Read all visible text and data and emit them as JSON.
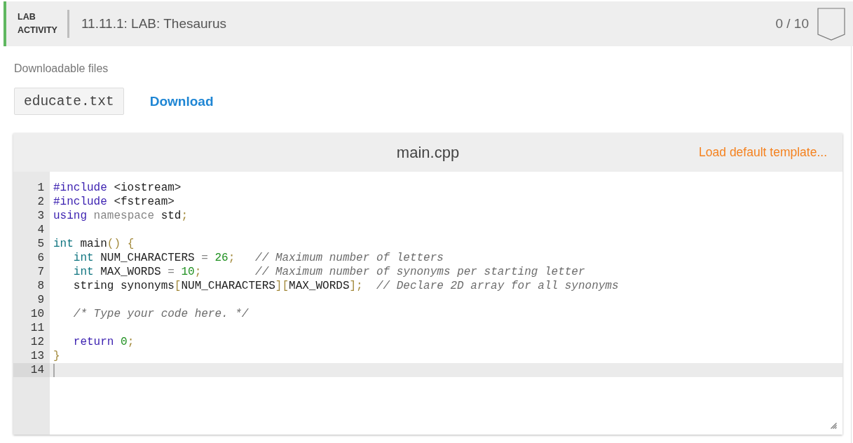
{
  "header": {
    "type_label": "LAB ACTIVITY",
    "title": "11.11.1: LAB: Thesaurus",
    "score": "0 / 10"
  },
  "downloads": {
    "label": "Downloadable files",
    "file": "educate.txt",
    "link": "Download"
  },
  "editor": {
    "filename": "main.cpp",
    "template_link": "Load default template...",
    "lines": [
      {
        "number": "1",
        "active": false,
        "tokens": [
          {
            "kind": "keyword",
            "text": "#include"
          },
          {
            "kind": "plain",
            "text": " <iostream>"
          }
        ]
      },
      {
        "number": "2",
        "active": false,
        "tokens": [
          {
            "kind": "keyword",
            "text": "#include"
          },
          {
            "kind": "plain",
            "text": " <fstream>"
          }
        ]
      },
      {
        "number": "3",
        "active": false,
        "tokens": [
          {
            "kind": "keyword",
            "text": "using"
          },
          {
            "kind": "muted",
            "text": " namespace"
          },
          {
            "kind": "plain",
            "text": " std"
          },
          {
            "kind": "punct",
            "text": ";"
          }
        ]
      },
      {
        "number": "4",
        "active": false
      },
      {
        "number": "5",
        "active": false,
        "tokens": [
          {
            "kind": "type",
            "text": "int"
          },
          {
            "kind": "plain",
            "text": " main"
          },
          {
            "kind": "punct",
            "text": "() {"
          }
        ]
      },
      {
        "number": "6",
        "active": false,
        "tokens": [
          {
            "kind": "type",
            "text": "   int"
          },
          {
            "kind": "plain",
            "text": " NUM_CHARACTERS "
          },
          {
            "kind": "muted",
            "text": "="
          },
          {
            "kind": "number",
            "text": " 26"
          },
          {
            "kind": "punct",
            "text": ";"
          },
          {
            "kind": "comment",
            "text": "   // Maximum number of letters"
          }
        ]
      },
      {
        "number": "7",
        "active": false,
        "tokens": [
          {
            "kind": "type",
            "text": "   int"
          },
          {
            "kind": "plain",
            "text": " MAX_WORDS "
          },
          {
            "kind": "muted",
            "text": "="
          },
          {
            "kind": "number",
            "text": " 10"
          },
          {
            "kind": "punct",
            "text": ";"
          },
          {
            "kind": "comment",
            "text": "        // Maximum number of synonyms per starting letter"
          }
        ]
      },
      {
        "number": "8",
        "active": false,
        "tokens": [
          {
            "kind": "plain",
            "text": "   string synonyms"
          },
          {
            "kind": "punct",
            "text": "["
          },
          {
            "kind": "plain",
            "text": "NUM_CHARACTERS"
          },
          {
            "kind": "punct",
            "text": "]["
          },
          {
            "kind": "plain",
            "text": "MAX_WORDS"
          },
          {
            "kind": "punct",
            "text": "];"
          },
          {
            "kind": "comment",
            "text": "  // Declare 2D array for all synonyms"
          }
        ]
      },
      {
        "number": "9",
        "active": false
      },
      {
        "number": "10",
        "active": false,
        "tokens": [
          {
            "kind": "comment",
            "text": "   /* Type your code here. */"
          }
        ]
      },
      {
        "number": "11",
        "active": false
      },
      {
        "number": "12",
        "active": false,
        "tokens": [
          {
            "kind": "keyword",
            "text": "   return"
          },
          {
            "kind": "number",
            "text": " 0"
          },
          {
            "kind": "punct",
            "text": ";"
          }
        ]
      },
      {
        "number": "13",
        "active": false,
        "tokens": [
          {
            "kind": "punct",
            "text": "}"
          }
        ]
      },
      {
        "number": "14",
        "active": true
      }
    ]
  }
}
